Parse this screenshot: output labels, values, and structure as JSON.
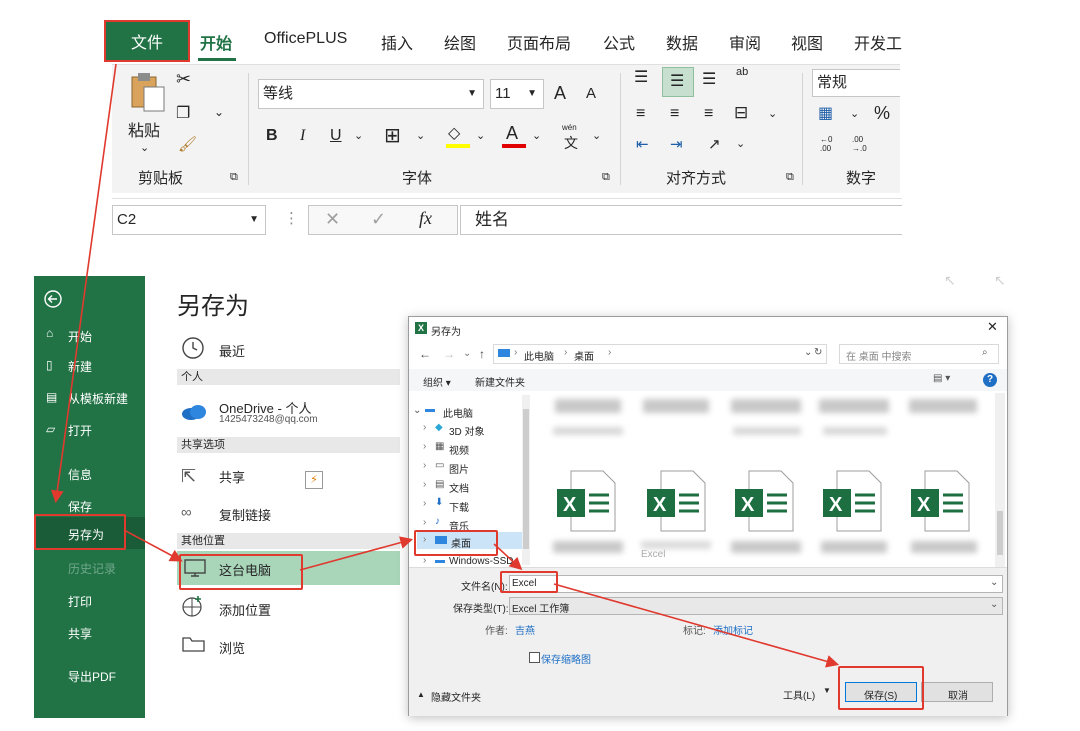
{
  "ribbon": {
    "tabs": [
      "文件",
      "开始",
      "OfficePLUS",
      "插入",
      "绘图",
      "页面布局",
      "公式",
      "数据",
      "审阅",
      "视图",
      "开发工"
    ],
    "clipboard": {
      "paste_label": "粘贴",
      "group_label": "剪贴板"
    },
    "font": {
      "font_name": "等线",
      "font_size": "11",
      "group_label": "字体",
      "bold": "B",
      "italic": "I",
      "underline": "U",
      "grow": "A",
      "shrink": "A",
      "font_color_letter": "A",
      "phonetic": "wén",
      "phonetic_char": "文"
    },
    "alignment": {
      "group_label": "对齐方式",
      "wrap": "ab"
    },
    "number": {
      "format": "常规",
      "group_label": "数字",
      "percent": "%",
      "inc_decimal": "←0\n.00",
      "dec_decimal": ".00\n→.0"
    }
  },
  "formula_bar": {
    "name_box": "C2",
    "fx": "fx",
    "formula_value": "姓名"
  },
  "backstage": {
    "nav": [
      {
        "label": "开始",
        "icon": "home-icon"
      },
      {
        "label": "新建",
        "icon": "new-document-icon"
      },
      {
        "label": "从模板新建",
        "icon": "template-icon"
      },
      {
        "label": "打开",
        "icon": "folder-open-icon"
      },
      {
        "label": "信息"
      },
      {
        "label": "保存"
      },
      {
        "label": "另存为"
      },
      {
        "label": "历史记录"
      },
      {
        "label": "打印"
      },
      {
        "label": "共享"
      },
      {
        "label": "导出PDF"
      }
    ],
    "title": "另存为",
    "recent": "最近",
    "section_personal": "个人",
    "onedrive_title": "OneDrive - 个人",
    "onedrive_email": "1425473248@qq.com",
    "section_shared": "共享选项",
    "share": "共享",
    "copy_link": "复制链接",
    "section_other": "其他位置",
    "this_pc": "这台电脑",
    "add_location": "添加位置",
    "browse": "浏览"
  },
  "dialog": {
    "title": "另存为",
    "breadcrumb": [
      "此电脑",
      "桌面"
    ],
    "search_placeholder": "在 桌面 中搜索",
    "organize": "组织 ▾",
    "new_folder": "新建文件夹",
    "tree": [
      "此电脑",
      "3D 对象",
      "视频",
      "图片",
      "文档",
      "下载",
      "音乐",
      "桌面",
      "Windows-SSD"
    ],
    "file_tile_partial": "Excel",
    "file_name_label": "文件名(N):",
    "file_name_value": "Excel",
    "save_type_label": "保存类型(T):",
    "save_type_value": "Excel 工作簿",
    "author_label": "作者:",
    "author_value": "吉燕",
    "tags_label": "标记:",
    "tags_value": "添加标记",
    "thumbnail_label": "保存缩略图",
    "hide_folders": "隐藏文件夹",
    "tools": "工具(L)",
    "save": "保存(S)",
    "cancel": "取消",
    "excel_letter": "X"
  },
  "colors": {
    "excel_green": "#217346",
    "annotation_red": "#e03a2f",
    "selection_green": "#a9d5b9"
  }
}
